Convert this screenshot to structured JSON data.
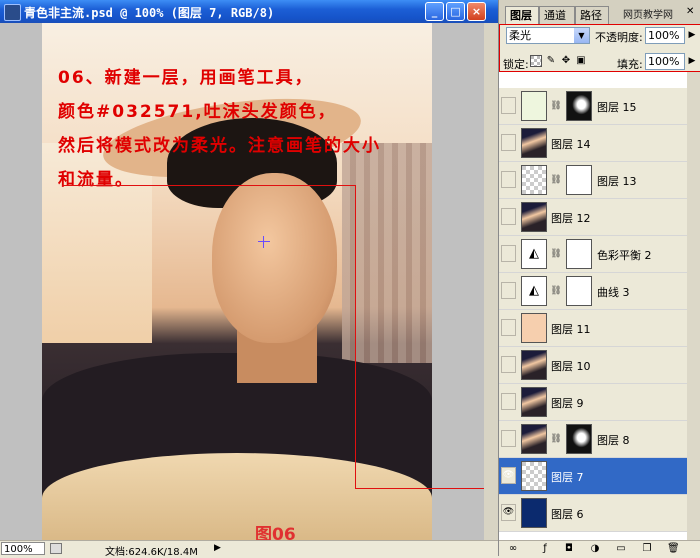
{
  "document": {
    "title": "青色非主流.psd @ 100% (图层 7, RGB/8)",
    "window_buttons": [
      "_",
      "□",
      "×"
    ],
    "instruction_lines": [
      "06、新建一层，用画笔工具，",
      "颜色#032571,吐沫头发颜色，",
      "然后将模式改为柔光。注意画笔的大小",
      "和流量。"
    ],
    "caption": "图06",
    "status": {
      "zoom": "100%",
      "doc_size": "文档:624.6K/18.4M"
    },
    "accent_color": "#e00000"
  },
  "panel": {
    "tabs": [
      "图层",
      "通道",
      "路径"
    ],
    "logo": "网页教学网",
    "blend_mode": "柔光",
    "opacity_label": "不透明度:",
    "opacity_value": "100%",
    "lock_label": "锁定:",
    "fill_label": "填充:",
    "fill_value": "100%",
    "layers": [
      {
        "name": "图层 15",
        "thumb": "solid",
        "thumb_color": "#eef6de",
        "mask": true,
        "visible": false
      },
      {
        "name": "图层 14",
        "thumb": "photo",
        "mask": false,
        "visible": false
      },
      {
        "name": "图层 13",
        "thumb": "checker",
        "mask": true,
        "visible": false
      },
      {
        "name": "图层 12",
        "thumb": "photo",
        "mask": false,
        "visible": false
      },
      {
        "name": "色彩平衡 2",
        "thumb": "adjust",
        "mask": true,
        "visible": false
      },
      {
        "name": "曲线 3",
        "thumb": "adjust",
        "mask": true,
        "visible": false
      },
      {
        "name": "图层 11",
        "thumb": "solid",
        "thumb_color": "#f6cfae",
        "mask": false,
        "visible": false
      },
      {
        "name": "图层 10",
        "thumb": "photo",
        "mask": false,
        "visible": false
      },
      {
        "name": "图层 9",
        "thumb": "photo",
        "mask": false,
        "visible": false
      },
      {
        "name": "图层 8",
        "thumb": "photo",
        "mask": true,
        "visible": false
      },
      {
        "name": "图层 7",
        "thumb": "checker",
        "mask": false,
        "visible": true,
        "selected": true
      },
      {
        "name": "图层 6",
        "thumb": "solid",
        "thumb_color": "#0b2a6e",
        "mask": false,
        "visible": true
      }
    ],
    "selected_color": "#3169c6"
  }
}
